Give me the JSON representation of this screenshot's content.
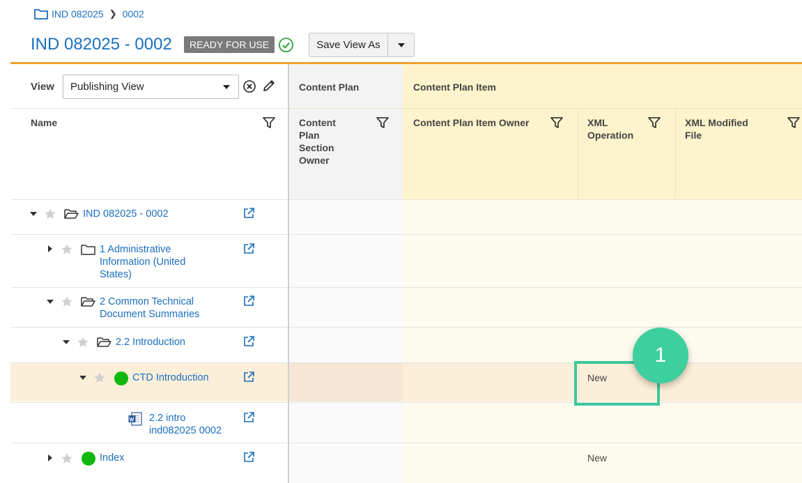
{
  "breadcrumb": {
    "root": "IND 082025",
    "child": "0002"
  },
  "header": {
    "title": "IND 082025 - 0002",
    "status_badge": "READY FOR USE",
    "save_view_label": "Save View As"
  },
  "view_bar": {
    "label": "View",
    "selected": "Publishing View"
  },
  "columns": {
    "name": "Name",
    "group_content_plan": "Content Plan",
    "group_content_plan_item": "Content Plan Item",
    "content_plan_section_owner": "Content Plan Section Owner",
    "content_plan_item_owner": "Content Plan Item Owner",
    "xml_operation": "XML Operation",
    "xml_modified_file": "XML Modified File"
  },
  "tree": [
    {
      "label": "IND 082025 - 0002",
      "icon": "folder-open-icon",
      "expanded": true,
      "xml_operation": ""
    },
    {
      "label": "1 Administrative Information (United States)",
      "icon": "folder-icon",
      "expanded": false,
      "xml_operation": ""
    },
    {
      "label": "2 Common Technical Document Summaries",
      "icon": "folder-open-icon",
      "expanded": true,
      "xml_operation": ""
    },
    {
      "label": "2.2 Introduction",
      "icon": "folder-open-icon",
      "expanded": true,
      "xml_operation": ""
    },
    {
      "label": "CTD Introduction",
      "icon": "green-status-dot-icon",
      "expanded": true,
      "xml_operation": "New",
      "selected": true
    },
    {
      "label": "2.2 intro ind082025 0002",
      "icon": "word-document-icon",
      "xml_operation": ""
    },
    {
      "label": "Index",
      "icon": "green-status-dot-icon",
      "expanded": false,
      "xml_operation": "New"
    }
  ],
  "callout": {
    "number": "1"
  },
  "colors": {
    "accent": "#1a6fbf",
    "rule": "#f0a030",
    "callout": "#3ecf9f",
    "status_dot": "#0fb80f"
  }
}
